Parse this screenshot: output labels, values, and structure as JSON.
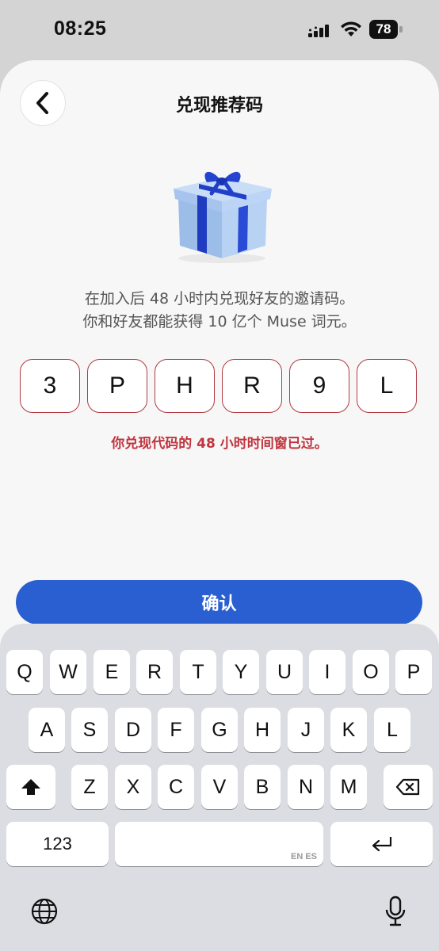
{
  "status_bar": {
    "time": "08:25",
    "battery": "78"
  },
  "header": {
    "title": "兑现推荐码"
  },
  "description": {
    "line1": "在加入后 48 小时内兑现好友的邀请码。",
    "line2": "你和好友都能获得 10 亿个 Muse 词元。"
  },
  "code": [
    "3",
    "P",
    "H",
    "R",
    "9",
    "L"
  ],
  "error_message": "你兑现代码的 48 小时时间窗已过。",
  "confirm_label": "确认",
  "gift_colors": {
    "box": "#a9c8f2",
    "ribbon": "#2140c9"
  },
  "accent_color": "#2a5fd2",
  "error_color": "#c0343e",
  "keyboard": {
    "row1": [
      "Q",
      "W",
      "E",
      "R",
      "T",
      "Y",
      "U",
      "I",
      "O",
      "P"
    ],
    "row2": [
      "A",
      "S",
      "D",
      "F",
      "G",
      "H",
      "J",
      "K",
      "L"
    ],
    "row3": [
      "Z",
      "X",
      "C",
      "V",
      "B",
      "N",
      "M"
    ],
    "numbers_label": "123",
    "space_hint": "EN ES"
  }
}
